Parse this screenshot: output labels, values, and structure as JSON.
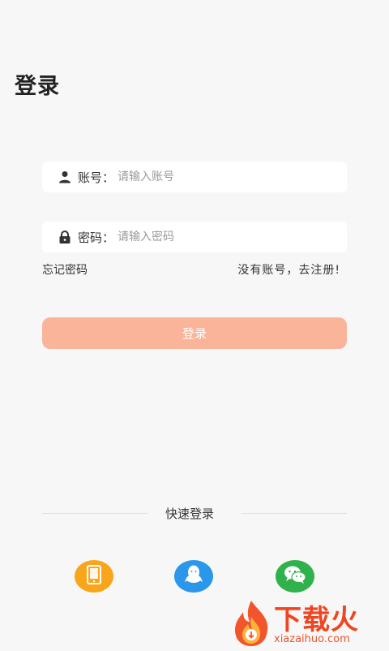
{
  "header": {
    "title": "登录"
  },
  "form": {
    "account": {
      "label": "账号：",
      "placeholder": "请输入账号",
      "value": ""
    },
    "password": {
      "label": "密码：",
      "placeholder": "请输入密码",
      "value": ""
    },
    "forgot_label": "忘记密码",
    "register_label": "没有账号，去注册!",
    "login_label": "登录"
  },
  "quick_login": {
    "title": "快速登录",
    "options": [
      {
        "icon": "phone-icon",
        "color": "#f9a51c"
      },
      {
        "icon": "qq-icon",
        "color": "#2b97ea"
      },
      {
        "icon": "wechat-icon",
        "color": "#2fb24c"
      }
    ]
  },
  "watermark": {
    "text": "下载火",
    "url": "xiazaihuo.com"
  },
  "colors": {
    "login_button": "#f9b49a",
    "background": "#f7f7f8"
  }
}
